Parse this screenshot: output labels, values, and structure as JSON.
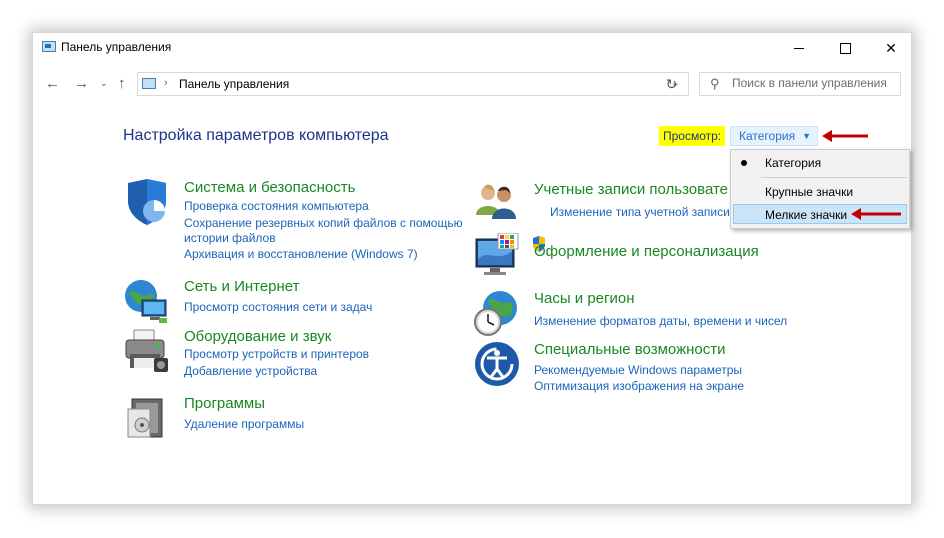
{
  "window": {
    "title": "Панель управления"
  },
  "nav": {
    "path": "Панель управления",
    "search_placeholder": "Поиск в панели управления"
  },
  "heading": "Настройка параметров компьютера",
  "viewby": {
    "label": "Просмотр:",
    "selected": "Категория",
    "options": [
      "Категория",
      "Крупные значки",
      "Мелкие значки"
    ]
  },
  "categories": {
    "system": {
      "title": "Система и безопасность",
      "links": [
        "Проверка состояния компьютера",
        "Сохранение резервных копий файлов с помощью",
        "истории файлов",
        "Архивация и восстановление (Windows 7)"
      ]
    },
    "network": {
      "title": "Сеть и Интернет",
      "links": [
        "Просмотр состояния сети и задач"
      ]
    },
    "hardware": {
      "title": "Оборудование и звук",
      "links": [
        "Просмотр устройств и принтеров",
        "Добавление устройства"
      ]
    },
    "programs": {
      "title": "Программы",
      "links": [
        "Удаление программы"
      ]
    },
    "accounts": {
      "title": "Учетные записи пользовате",
      "links": [
        "Изменение типа учетной записи"
      ]
    },
    "appearance": {
      "title": "Оформление и персонализация",
      "links": []
    },
    "clock": {
      "title": "Часы и регион",
      "links": [
        "Изменение форматов даты, времени и чисел"
      ]
    },
    "access": {
      "title": "Специальные возможности",
      "links": [
        "Рекомендуемые Windows параметры",
        "Оптимизация изображения на экране"
      ]
    }
  }
}
